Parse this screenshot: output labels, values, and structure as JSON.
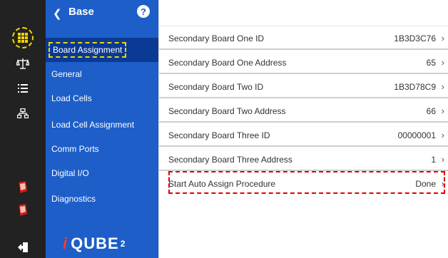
{
  "rail": {
    "icons": [
      "grid-icon",
      "scale-icon",
      "list-icon",
      "network-icon",
      "book-red-icon",
      "book-red-icon",
      "logout-icon"
    ]
  },
  "nav": {
    "back_glyph": "❮",
    "title": "Base",
    "help_glyph": "?",
    "items": [
      {
        "label": "Board Assignment",
        "active": true
      },
      {
        "label": "General"
      },
      {
        "label": "Load Cells"
      },
      {
        "label": "Load Cell Assignment"
      },
      {
        "label": "Comm Ports"
      },
      {
        "label": "Digital I/O"
      },
      {
        "label": "Diagnostics"
      }
    ],
    "logo": {
      "i": "i",
      "text": "QUBE",
      "sup": "2"
    }
  },
  "settings": [
    {
      "label": "Secondary Board One ID",
      "value": "1B3D3C76"
    },
    {
      "label": "Secondary Board One Address",
      "value": "65"
    },
    {
      "label": "Secondary Board Two ID",
      "value": "1B3D78C9"
    },
    {
      "label": "Secondary Board Two Address",
      "value": "66"
    },
    {
      "label": "Secondary Board Three ID",
      "value": "00000001"
    },
    {
      "label": "Secondary Board Three Address",
      "value": "1"
    },
    {
      "label": "Start Auto Assign Procedure",
      "value": "Done"
    }
  ],
  "chevron": "›",
  "colors": {
    "nav": "#1d5ec9",
    "nav_active": "#0a3a94",
    "rail": "#222222",
    "highlight_yellow": "#f2d600",
    "highlight_red": "#e00000"
  }
}
